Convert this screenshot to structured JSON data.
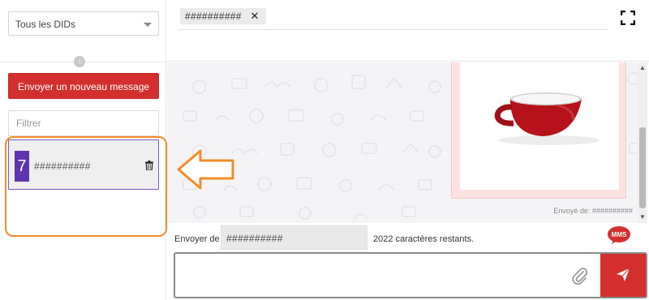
{
  "sidebar": {
    "did_select_value": "Tous les DIDs",
    "new_message_label": "Envoyer un nouveau message",
    "filter_placeholder": "Filtrer",
    "conversations": [
      {
        "count": "7",
        "name": "##########"
      }
    ]
  },
  "topbar": {
    "recipient_tag": "##########"
  },
  "messages": {
    "sent_from": "Envoyé de: ##########"
  },
  "composer": {
    "sender_label": "Envoyer de",
    "sender_value": "##########",
    "chars_remaining": "2022 caractères restants.",
    "mms_badge": "MMS"
  },
  "colors": {
    "accent_red": "#d32f2f",
    "badge_purple": "#5e35b1",
    "highlight_orange": "#f28c28",
    "mms_card_pink": "#ffe1e1"
  },
  "icons": [
    "chevron-down-icon",
    "arrow-down-circle-icon",
    "trash-icon",
    "close-icon",
    "fullscreen-icon",
    "paperclip-icon",
    "send-icon",
    "coffee-cup-image"
  ]
}
